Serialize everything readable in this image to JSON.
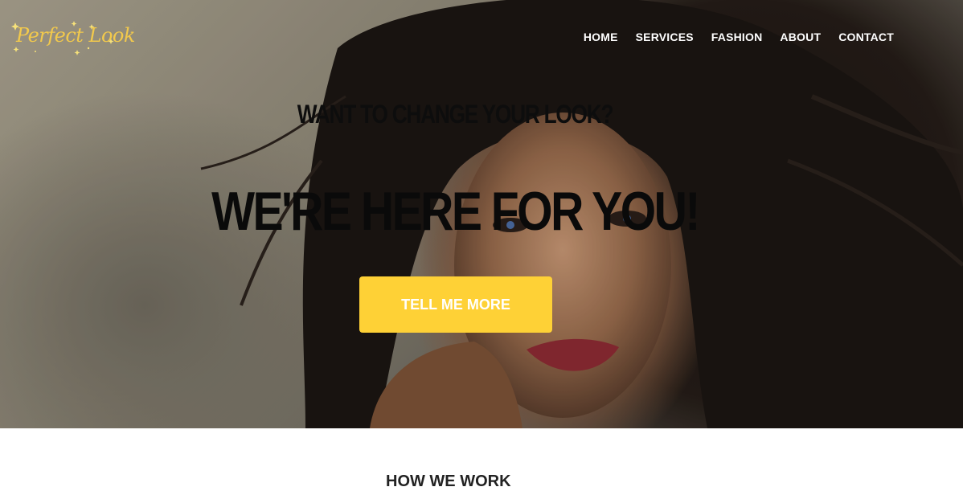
{
  "brand": {
    "logo_text": "Perfect Look",
    "accent_color": "#fed136"
  },
  "nav": {
    "items": [
      {
        "label": "HOME"
      },
      {
        "label": "SERVICES"
      },
      {
        "label": "FASHION"
      },
      {
        "label": "ABOUT"
      },
      {
        "label": "CONTACT"
      }
    ]
  },
  "hero": {
    "subheading": "WANT TO CHANGE YOUR LOOK?",
    "heading": "WE'RE HERE FOR YOU!",
    "cta_label": "TELL ME MORE"
  },
  "next_section": {
    "heading": "HOW WE WORK"
  }
}
